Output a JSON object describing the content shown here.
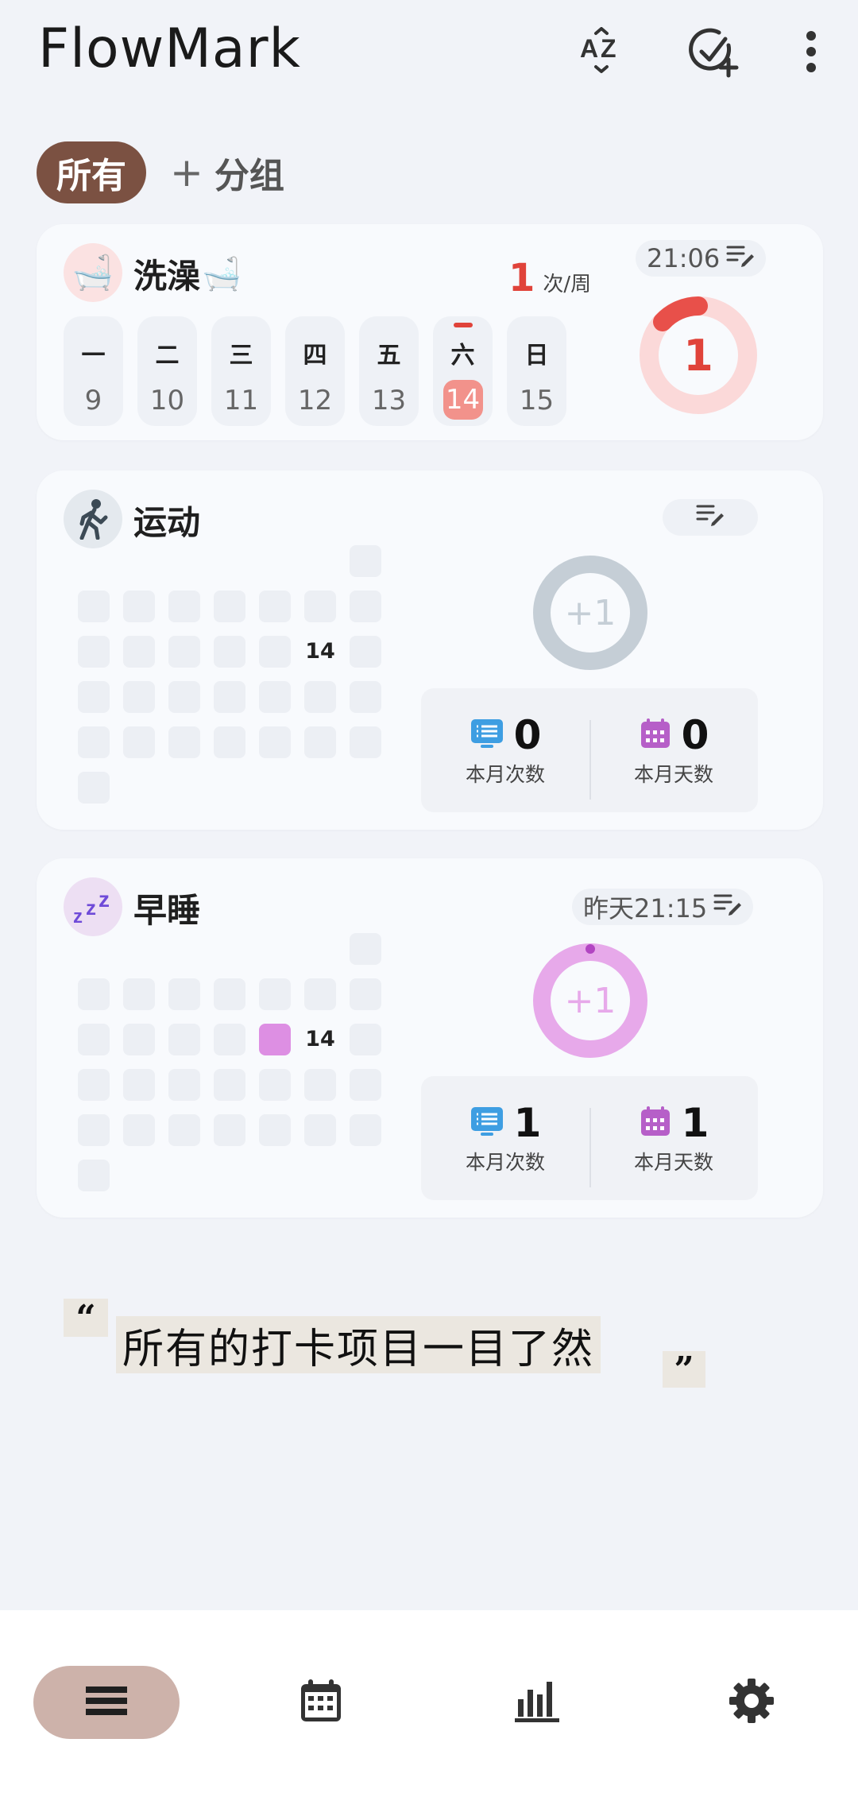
{
  "app": {
    "title": "FlowMark"
  },
  "header": {
    "sort_icon": "sort-az-icon",
    "add_icon": "add-check-icon",
    "more_icon": "more-vert-icon"
  },
  "groups": {
    "all_label": "所有",
    "add_label": "分组",
    "add_prefix": "+"
  },
  "cards": [
    {
      "title": "洗澡",
      "emoji": "🛁",
      "frequency": {
        "count": "1",
        "unit": "次/周"
      },
      "time": "21:06",
      "week_days": [
        {
          "label": "一",
          "date": "9"
        },
        {
          "label": "二",
          "date": "10"
        },
        {
          "label": "三",
          "date": "11"
        },
        {
          "label": "四",
          "date": "12"
        },
        {
          "label": "五",
          "date": "13"
        },
        {
          "label": "六",
          "date": "14",
          "today": true,
          "checked": true
        },
        {
          "label": "日",
          "date": "15"
        }
      ],
      "progress": {
        "done": 1,
        "goal": 1,
        "label": "1"
      },
      "accent": "#e0433a"
    },
    {
      "title": "运动",
      "icon": "walking-person-icon",
      "time": "",
      "ring_label": "+1",
      "heatmap_today": "14",
      "heatmap_checked_days": [],
      "stats": {
        "month_count": "0",
        "month_count_label": "本月次数",
        "month_days": "0",
        "month_days_label": "本月天数"
      },
      "ring_color": "#c5ced6"
    },
    {
      "title": "早睡",
      "icon": "zzz-icon",
      "time": "昨天21:15",
      "ring_label": "+1",
      "heatmap_today": "14",
      "heatmap_checked_days": [
        "13"
      ],
      "stats": {
        "month_count": "1",
        "month_count_label": "本月次数",
        "month_days": "1",
        "month_days_label": "本月天数"
      },
      "ring_color": "#e7a9ea"
    }
  ],
  "quote": {
    "open": "“",
    "text": "所有的打卡项目一目了然",
    "close": "”"
  },
  "bottom_nav": [
    {
      "name": "list-icon",
      "active": true
    },
    {
      "name": "calendar-icon",
      "active": false
    },
    {
      "name": "stats-icon",
      "active": false
    },
    {
      "name": "settings-icon",
      "active": false
    }
  ]
}
